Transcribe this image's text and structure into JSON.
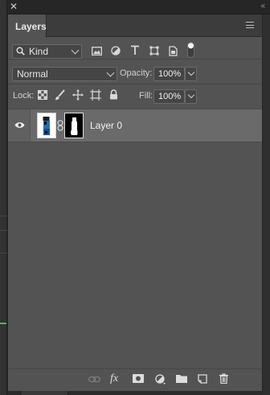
{
  "window": {
    "close_label": "✕",
    "collapse_label": "«"
  },
  "panel": {
    "tab_label": "Layers"
  },
  "filter": {
    "kind_label": "Kind",
    "icons": [
      "image-filter-icon",
      "adjustment-filter-icon",
      "type-filter-icon",
      "shape-filter-icon",
      "smart-object-filter-icon",
      "filter-toggle-icon"
    ]
  },
  "blend": {
    "mode": "Normal",
    "opacity_label": "Opacity:",
    "opacity_value": "100%"
  },
  "lock": {
    "label": "Lock:",
    "fill_label": "Fill:",
    "fill_value": "100%",
    "icons": [
      "lock-transparent-icon",
      "lock-image-icon",
      "lock-position-icon",
      "lock-artboard-icon",
      "lock-all-icon"
    ]
  },
  "layers": [
    {
      "name": "Layer 0",
      "visible": true,
      "has_mask": true
    }
  ],
  "footer": {
    "fx_label": "fx",
    "icons": [
      "link-layers-icon",
      "fx-icon",
      "add-mask-icon",
      "adjustment-layer-icon",
      "new-group-icon",
      "new-layer-icon",
      "delete-layer-icon"
    ]
  },
  "colors": {
    "panel_bg": "#535353",
    "selected_row": "#6a6a6a",
    "accent_green": "#3ec14a"
  }
}
